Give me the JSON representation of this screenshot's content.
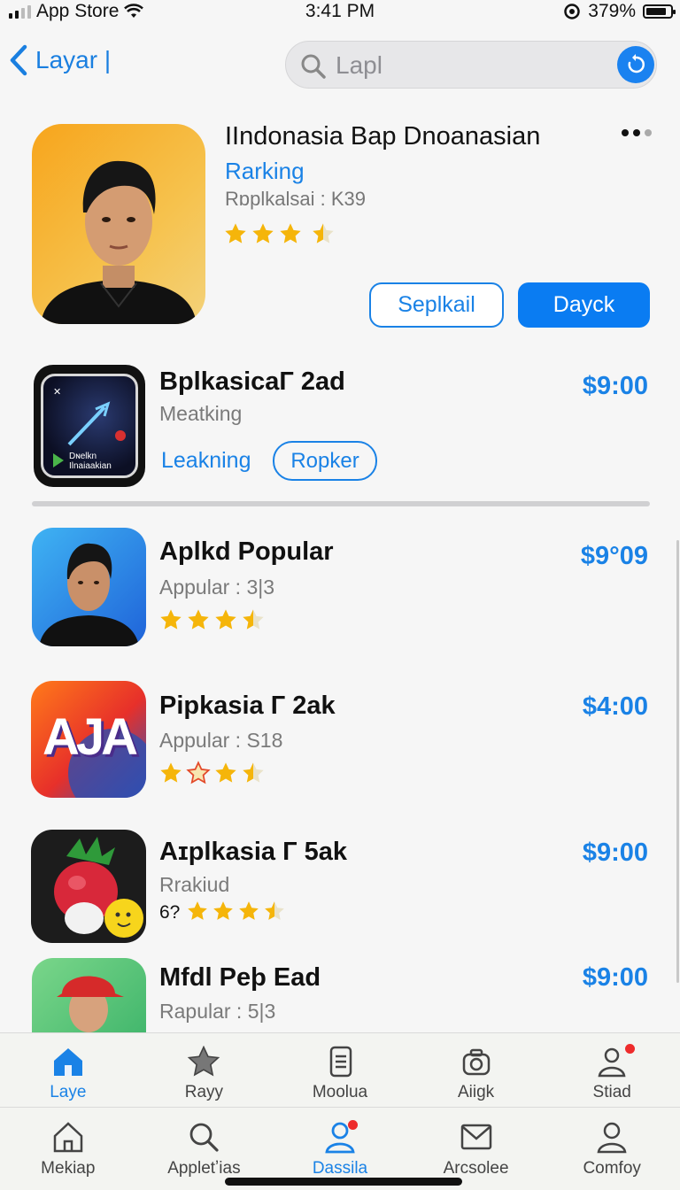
{
  "status_bar": {
    "carrier": "App Store",
    "time": "3:41 PM",
    "battery": "379%"
  },
  "nav": {
    "back_label": "Layar |",
    "search_placeholder": "Lapl"
  },
  "featured": {
    "title": "IIndonasia Bap Dnoanasian",
    "subtitle": "Rarking",
    "meta": "Rɒplkalsai : K39",
    "rating_stars": 3.5,
    "outline_button": "Seplkail",
    "primary_button": "Dayck"
  },
  "second_app": {
    "title": "BplkasicaГ 2ad",
    "meta": "Meatking",
    "link": "Leakning",
    "button": "Ropker",
    "price": "$9:00",
    "icon_text": "Dɴelkn\nIlnaiaakian"
  },
  "list": [
    {
      "title": "Aplkd Popular",
      "meta": "Appular : 3|3",
      "price": "$9°09",
      "rating_stars": 3.5
    },
    {
      "title": "Pipkasia Г 2ak",
      "meta": "Appular : S18",
      "price": "$4:00",
      "rating_stars": 3.5,
      "icon_text": "AJA"
    },
    {
      "title": "Aɪplkasia Г 5ak",
      "meta": "Rrakiud",
      "price": "$9:00",
      "rating_prefix": "6?",
      "rating_stars": 3.5
    },
    {
      "title": "Mfdl Peþ Ead",
      "meta": "Rapular : 5|3",
      "price": "$9:00"
    }
  ],
  "tabbar_top": [
    {
      "label": "Laye",
      "icon": "home-icon",
      "active": true
    },
    {
      "label": "Rayy",
      "icon": "star-icon"
    },
    {
      "label": "Moolua",
      "icon": "document-icon"
    },
    {
      "label": "Aiigk",
      "icon": "camera-icon"
    },
    {
      "label": "Stiad",
      "icon": "person-icon",
      "badge": true
    }
  ],
  "tabbar_bottom": [
    {
      "label": "Mekiap",
      "icon": "house-outline-icon"
    },
    {
      "label": "Appletʼias",
      "icon": "search-icon"
    },
    {
      "label": "Dassila",
      "icon": "person-icon",
      "active": true,
      "badge": true
    },
    {
      "label": "Arcsolee",
      "icon": "mail-icon"
    },
    {
      "label": "Comfoy",
      "icon": "person-outline-icon"
    }
  ],
  "colors": {
    "accent": "#1a82e6",
    "badge": "#ee2b2b",
    "star": "#f5b50a"
  }
}
